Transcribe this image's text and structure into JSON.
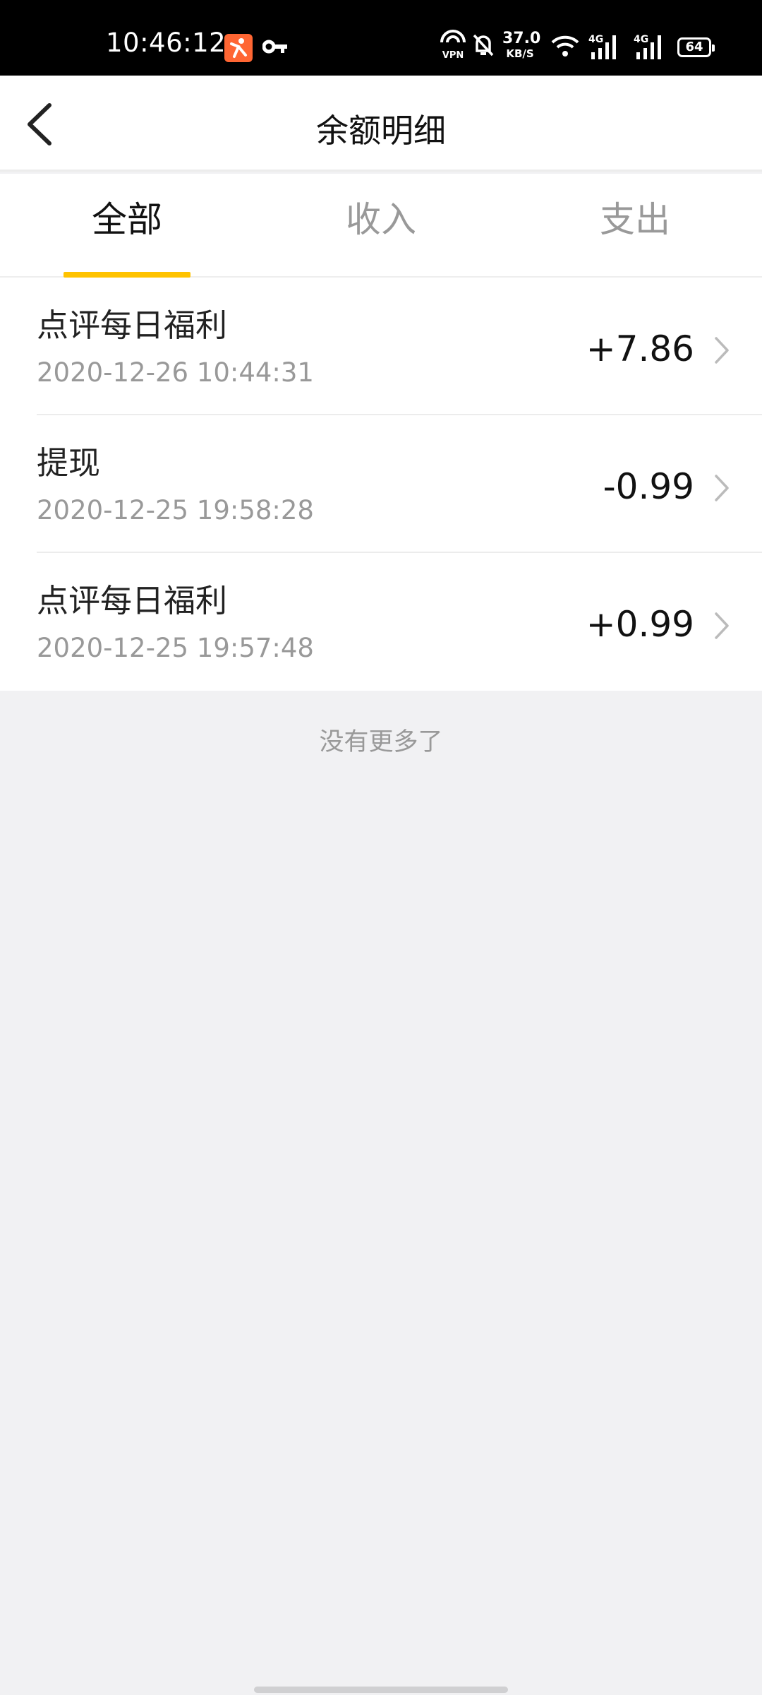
{
  "status_bar": {
    "time": "10:46:12",
    "net_speed_value": "37.0",
    "net_speed_unit": "KB/S",
    "battery": "64",
    "icons": [
      "app-icon",
      "key-icon",
      "vpn-icon",
      "mute-icon",
      "wifi-icon",
      "signal-4g-icon",
      "signal-4g-icon",
      "battery-icon"
    ],
    "text_color": "#ffffff",
    "background": "#000000"
  },
  "header": {
    "title": "余额明细",
    "back_icon": "chevron-left-icon"
  },
  "tabs": [
    {
      "label": "全部",
      "active": true
    },
    {
      "label": "收入",
      "active": false
    },
    {
      "label": "支出",
      "active": false
    }
  ],
  "accent_color": "#ffc300",
  "transactions": [
    {
      "title": "点评每日福利",
      "time": "2020-12-26 10:44:31",
      "amount": "+7.86"
    },
    {
      "title": "提现",
      "time": "2020-12-25 19:58:28",
      "amount": "-0.99"
    },
    {
      "title": "点评每日福利",
      "time": "2020-12-25 19:57:48",
      "amount": "+0.99"
    }
  ],
  "footer": {
    "no_more_text": "没有更多了"
  }
}
